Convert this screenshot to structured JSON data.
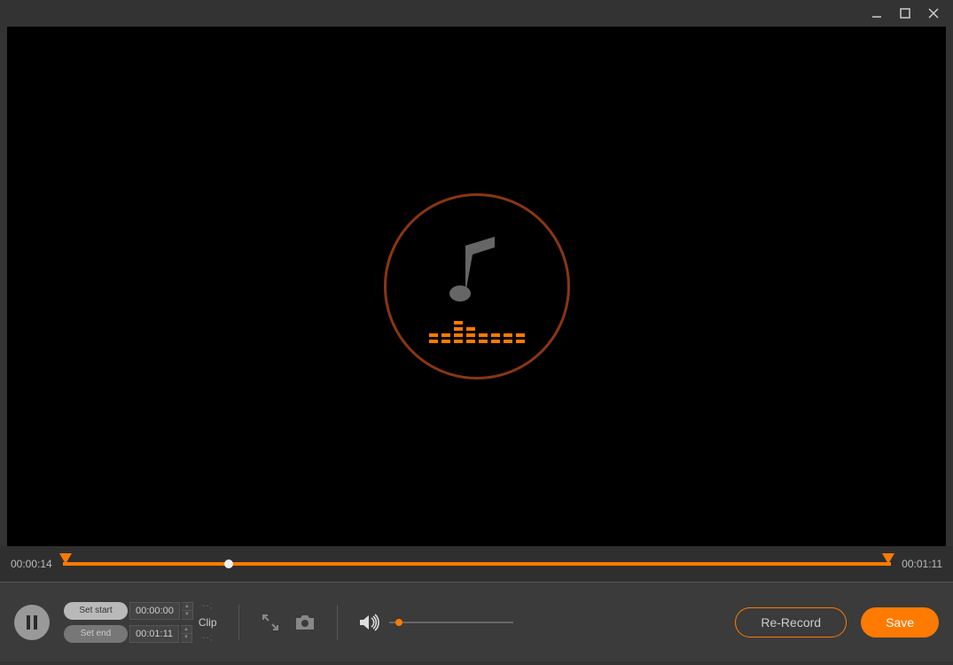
{
  "colors": {
    "accent": "#ff7a00"
  },
  "window": {
    "minimize": "minimize",
    "maximize": "maximize",
    "close": "close"
  },
  "preview": {
    "icon": "music-note"
  },
  "timeline": {
    "current": "00:00:14",
    "total": "00:01:11",
    "playhead_percent": 20
  },
  "clip": {
    "set_start_label": "Set start",
    "set_end_label": "Set end",
    "start_time": "00:00:00",
    "end_time": "00:01:11",
    "clip_label": "Clip",
    "dash_in": "--;",
    "dash_out": "--;"
  },
  "volume": {
    "level_percent": 5
  },
  "actions": {
    "rerecord": "Re-Record",
    "save": "Save"
  }
}
